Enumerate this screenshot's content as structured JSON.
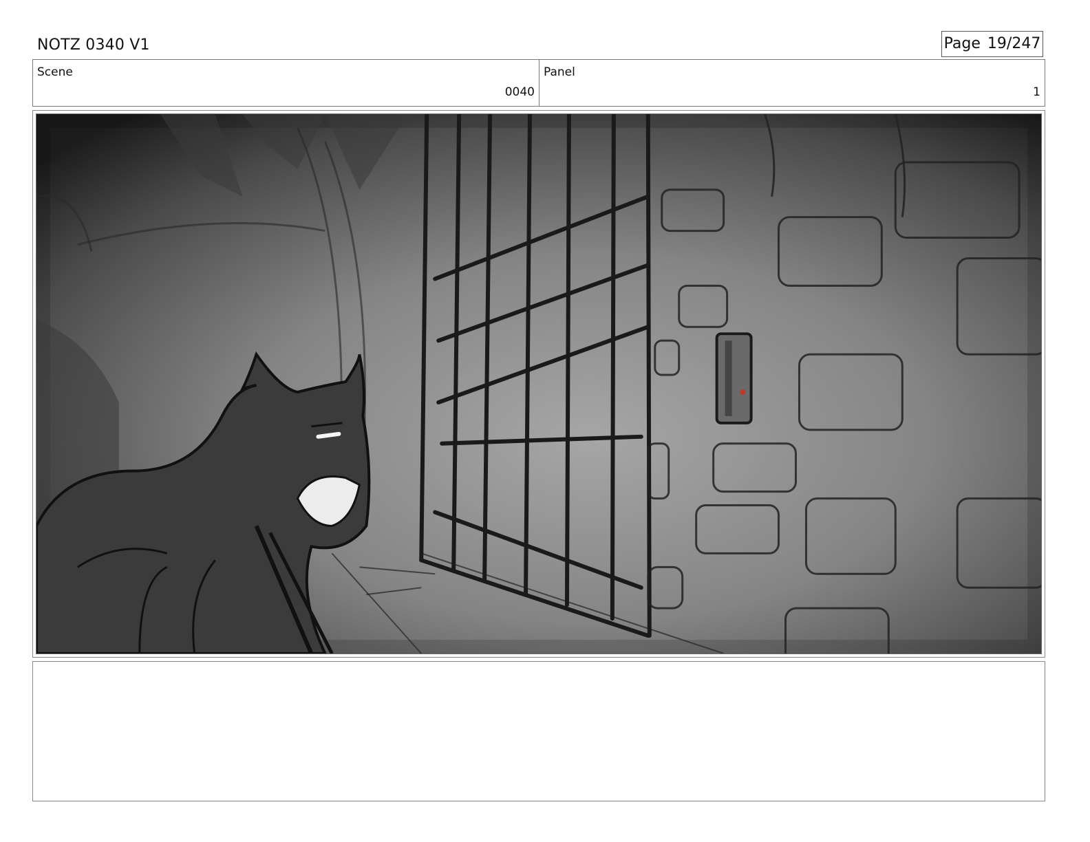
{
  "document": {
    "title": "NOTZ 0340 V1"
  },
  "page": {
    "label": "Page",
    "number": "19/247"
  },
  "header": {
    "scene": {
      "label": "Scene",
      "value": "0040"
    },
    "panel": {
      "label": "Panel",
      "value": "1"
    }
  },
  "notes": {
    "text": ""
  },
  "colors": {
    "border": "#777777",
    "sketch_line": "#1a1a1a",
    "background_light": "#9a9a9a",
    "background_dark": "#1c1c1c",
    "accent_red": "#c0392b"
  }
}
